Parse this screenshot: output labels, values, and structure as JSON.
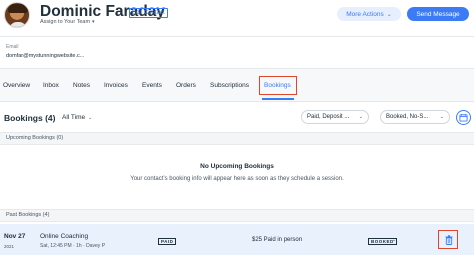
{
  "header": {
    "name": "Dominic Faraday",
    "edit_contact": "Edit Contact",
    "assign_team": "Assign to Your Team",
    "more_actions": "More Actions",
    "send_message": "Send Message"
  },
  "contact": {
    "email_label": "Email",
    "email_value": "domfar@mystunningwebsite.c..."
  },
  "tabs": [
    {
      "label": "Overview"
    },
    {
      "label": "Inbox"
    },
    {
      "label": "Notes"
    },
    {
      "label": "Invoices"
    },
    {
      "label": "Events"
    },
    {
      "label": "Orders"
    },
    {
      "label": "Subscriptions"
    },
    {
      "label": "Bookings",
      "active": true
    }
  ],
  "bookings": {
    "title": "Bookings (4)",
    "time_filter": "All Time",
    "payment_filter": "Paid, Deposit ...",
    "status_filter": "Booked, No-S...",
    "upcoming": {
      "header": "Upcoming Bookings (0)",
      "empty_title": "No Upcoming Bookings",
      "empty_message": "Your contact’s booking info will appear here as soon as they schedule a session."
    },
    "past": {
      "header": "Past Bookings (4)",
      "rows": [
        {
          "date": "Nov 27",
          "year": "2021",
          "service": "Online Coaching",
          "details": "Sat, 12:45 PM  ·  1h  ·  Davey P",
          "payment_badge": "PAID",
          "payment_info": "$25 Paid in person",
          "status_badge": "BOOKED"
        }
      ]
    }
  },
  "icons": {
    "more_actions_caret": "chevron-down-icon",
    "calendar": "calendar-icon",
    "trash": "trash-icon"
  },
  "colors": {
    "accent": "#3b7cf6",
    "highlight_box": "#e0462e",
    "row_highlight": "#e9f1fd"
  }
}
